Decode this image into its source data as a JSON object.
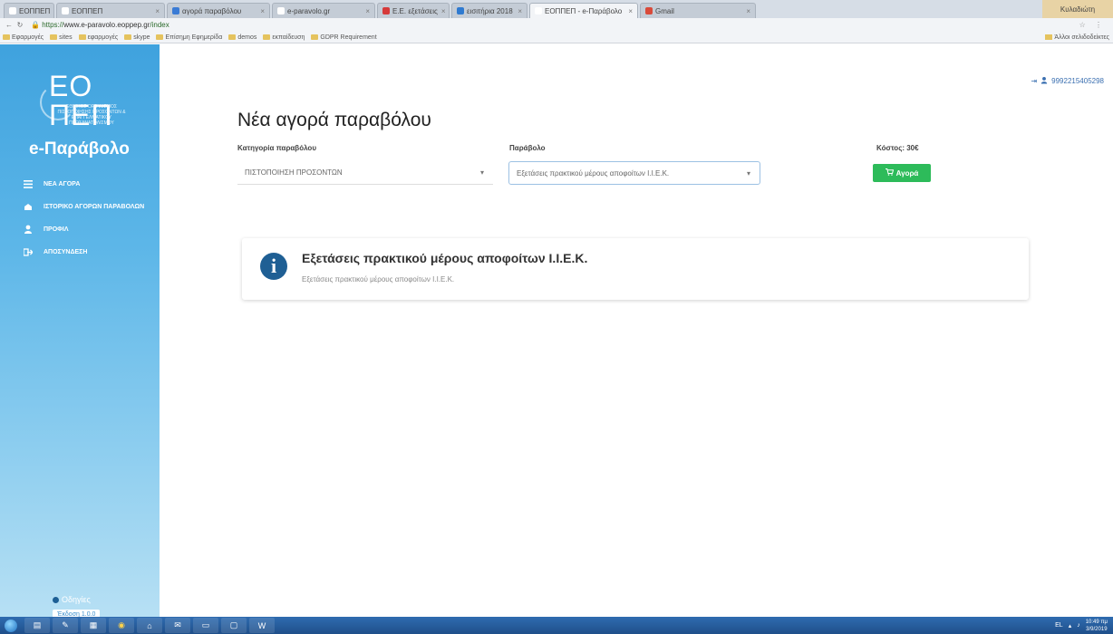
{
  "browser": {
    "tabs": [
      {
        "label": "ΕΟΠΠΕΠ",
        "color": "#ffffff"
      },
      {
        "label": "ΕΟΠΠΕΠ",
        "color": "#ffffff"
      },
      {
        "label": "αγορά παραβόλου",
        "color": "#3a7bd5"
      },
      {
        "label": "e-paravolo.gr",
        "color": "#ffffff"
      },
      {
        "label": "Ε.Ε. εξετάσεις",
        "color": "#d63a3a"
      },
      {
        "label": "εισιτήρια 2018",
        "color": "#2f7ad0"
      },
      {
        "label": "ΕΟΠΠΕΠ - e-Παράβολο",
        "color": "#ffffff",
        "active": true
      },
      {
        "label": "Gmail",
        "color": "#d94a3a"
      }
    ],
    "window_user": "Κυλαδιώτη",
    "url_scheme": "https://",
    "url_host": "www.e-paravolo.eoppep.gr",
    "url_path": "/index",
    "bookmarks": [
      "Εφαρμογές",
      "sites",
      "εφαρμογές",
      "skype",
      "Επίσημη Εφημερίδα",
      "demos",
      "εκπαίδευση",
      "GDPR Requirement"
    ],
    "other_bookmarks": "Άλλοι σελιδοδείκτες"
  },
  "sidebar": {
    "logo_text": "ΕΟΠΠΕΠ",
    "logo_subtitle": "ΕΘΝΙΚΟΣ ΟΡΓΑΝΙΣΜΟΣ ΠΙΣΤΟΠΟΙΗΣΗΣ ΠΡΟΣΟΝΤΩΝ & ΕΠΑΓΓΕΛΜΑΤΙΚΟΥ ΠΡΟΣΑΝΑΤΟΛΙΣΜΟΥ",
    "brand": "e-Παράβολο",
    "menu": [
      {
        "label": "ΝΕΑ ΑΓΟΡΑ",
        "icon": "list-icon"
      },
      {
        "label": "ΙΣΤΟΡΙΚΟ ΑΓΟΡΩΝ ΠΑΡΑΒΟΛΩΝ",
        "icon": "history-icon"
      },
      {
        "label": "ΠΡΟΦΙΛ",
        "icon": "user-icon"
      },
      {
        "label": "ΑΠΟΣΥΝΔΕΣΗ",
        "icon": "logout-icon"
      }
    ],
    "help_link": "Οδηγίες",
    "version": "Έκδοση 1.0.0"
  },
  "header": {
    "user": "9992215405298"
  },
  "main": {
    "title": "Νέα αγορά παραβόλου",
    "category_label": "Κατηγορία παραβόλου",
    "category_value": "ΠΙΣΤΟΠΟΙΗΣΗ ΠΡΟΣΟΝΤΩΝ",
    "fee_label": "Παράβολο",
    "fee_value": "Εξετάσεις πρακτικού μέρους αποφοίτων Ι.Ι.Ε.Κ.",
    "cost_label": "Κόστος: 30€",
    "buy_label": "Αγορά"
  },
  "info": {
    "title": "Εξετάσεις πρακτικού μέρους αποφοίτων Ι.Ι.Ε.Κ.",
    "description": "Εξετάσεις πρακτικού μέρους αποφοίτων Ι.Ι.Ε.Κ."
  },
  "taskbar": {
    "language": "EL",
    "time": "10:49 πμ",
    "date": "3/9/2019"
  }
}
